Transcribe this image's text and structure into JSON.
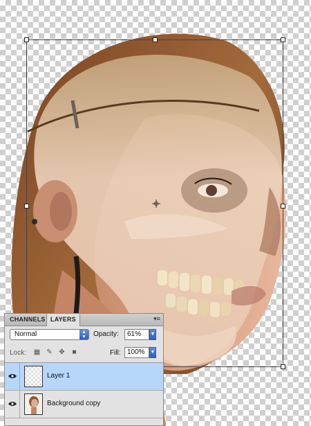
{
  "panel": {
    "tabs": [
      {
        "label": "CHANNELS",
        "active": false
      },
      {
        "label": "LAYERS",
        "active": true
      }
    ],
    "menu_icon": "panel-menu-icon",
    "blend_mode": "Normal",
    "opacity_label": "Opacity:",
    "opacity_value": "61%",
    "lock_label": "Lock:",
    "lock_icons": [
      "lock-transparent-icon",
      "lock-paint-icon",
      "lock-move-icon",
      "lock-all-icon"
    ],
    "fill_label": "Fill:",
    "fill_value": "100%",
    "layers": [
      {
        "name": "Layer 1",
        "visible": true,
        "selected": true
      },
      {
        "name": "Background copy",
        "visible": true,
        "selected": false
      }
    ]
  },
  "canvas": {
    "description_colors": {
      "skull": "#e9cdb6",
      "hair": "#8a5a32",
      "skin": "#e4b39a"
    }
  }
}
